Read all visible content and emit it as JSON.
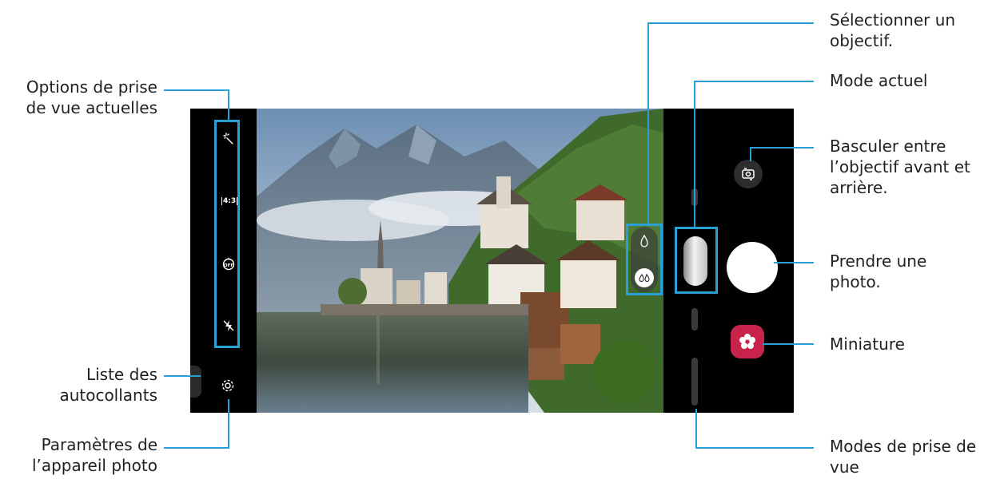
{
  "labels": {
    "options_line1": "Options de prise",
    "options_line2": "de vue actuelles",
    "stickers_line1": "Liste des",
    "stickers_line2": "autocollants",
    "settings_line1": "Paramètres de",
    "settings_line2": "l’appareil photo",
    "lens_line1": "Sélectionner un",
    "lens_line2": "objectif.",
    "mode": "Mode actuel",
    "switch_line1": "Basculer entre",
    "switch_line2": "l’objectif avant et",
    "switch_line3": "arrière.",
    "capture_line1": "Prendre une",
    "capture_line2": "photo.",
    "thumbnail": "Miniature",
    "modes_line1": "Modes de prise de",
    "modes_line2": "vue"
  },
  "camera": {
    "ratio_label": "4:3",
    "timer_label": "OFF"
  },
  "icons": {
    "options": [
      "magic-wand-icon",
      "aspect-ratio-icon",
      "timer-off-icon",
      "flash-off-icon"
    ],
    "settings": "gear-icon",
    "lens": [
      "wide-lens-icon",
      "ultra-wide-lens-icon"
    ],
    "switch": "camera-switch-icon",
    "thumbnail": "flower-icon"
  },
  "colors": {
    "callout": "#2a9fd6",
    "thumbnail": "#c8244b",
    "text": "#231f20"
  }
}
